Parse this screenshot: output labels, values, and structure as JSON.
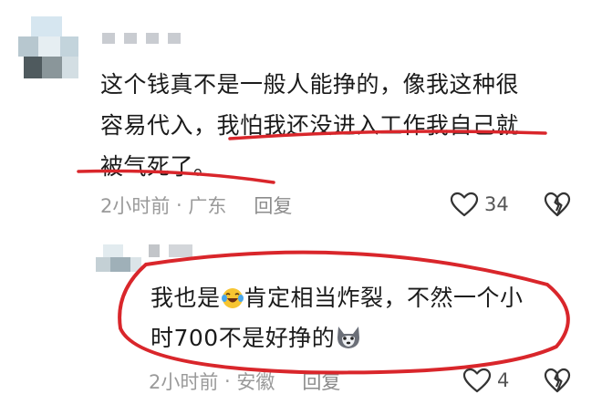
{
  "comment": {
    "text": "这个钱真不是一般人能挣的，像我这种很\n容易代入，我怕我还没进入工作我自己就\n被气死了。",
    "time": "2小时前",
    "location": "广东",
    "reply_label": "回复",
    "likes": "34"
  },
  "reply": {
    "text_part1": "我也是",
    "text_part2": "肯定相当炸裂，不然一个小\n时700不是好挣的",
    "time": "2小时前",
    "location": "安徽",
    "reply_label": "回复",
    "likes": "4"
  },
  "colors": {
    "annotation": "#d9262b",
    "meta_text": "#9a9a9a",
    "body_text": "#1b1b1b"
  },
  "icons": [
    "heart-outline-icon",
    "broken-heart-icon",
    "laughing-crying-emoji",
    "wolf-dog-emoji"
  ]
}
